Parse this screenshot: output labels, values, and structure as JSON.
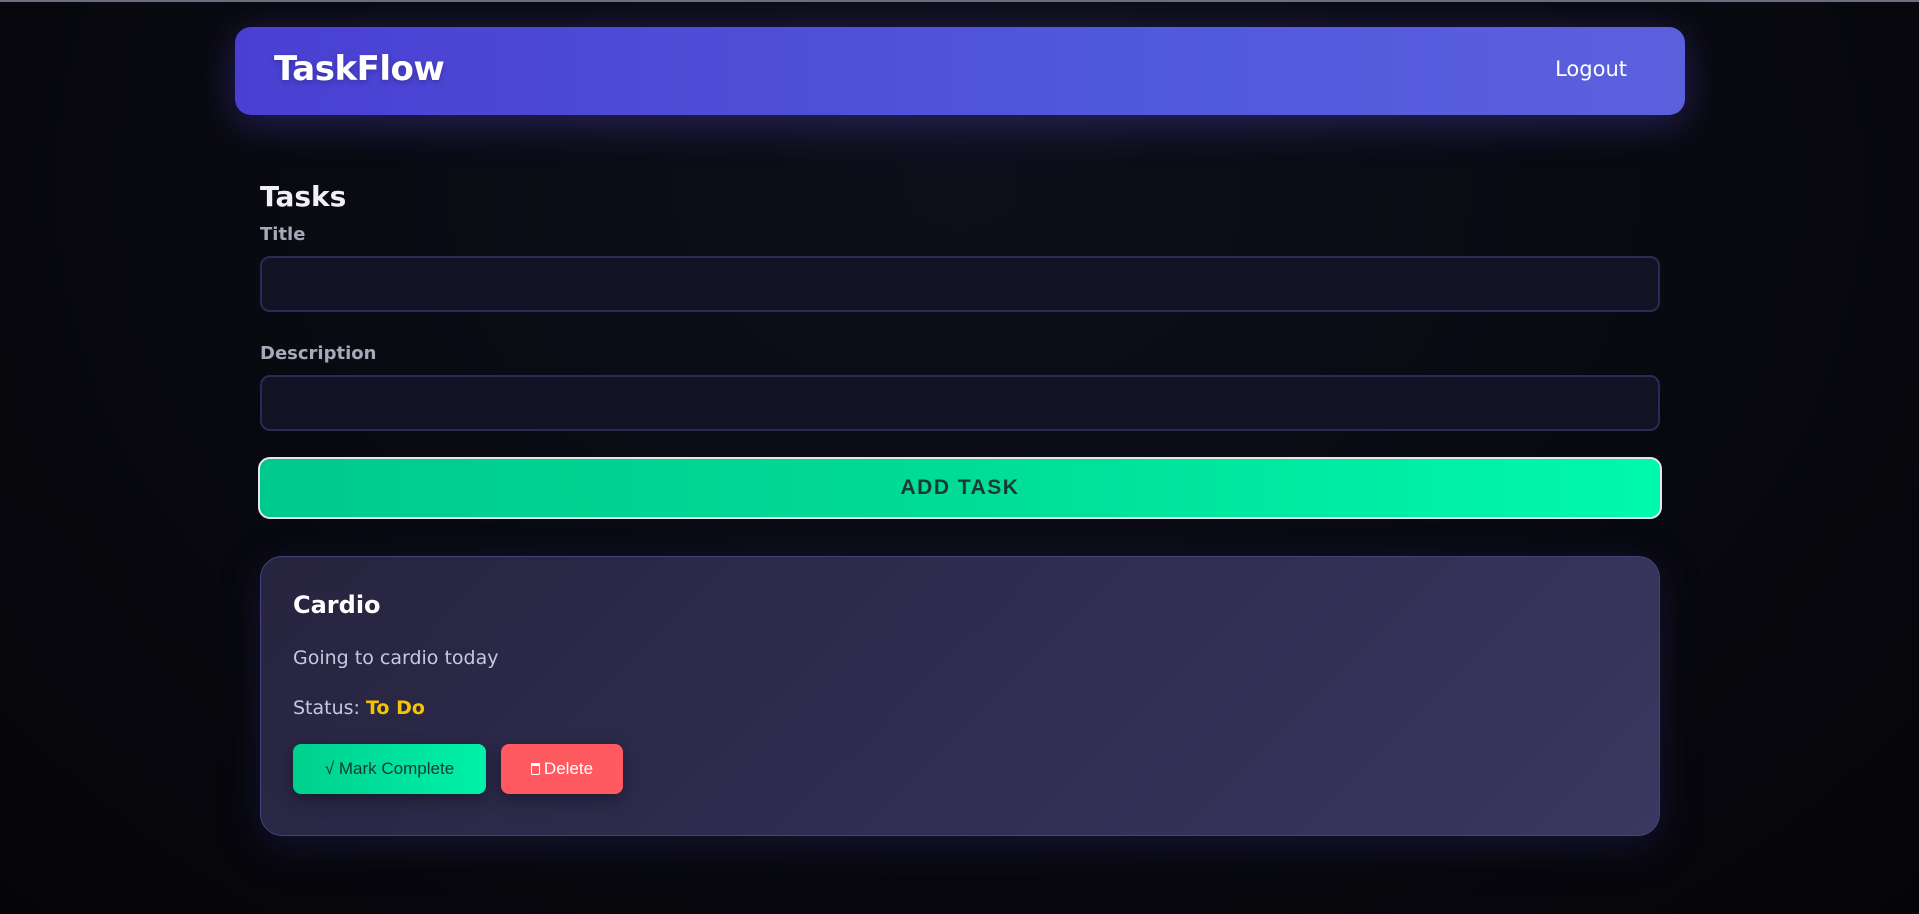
{
  "header": {
    "brand": "TaskFlow",
    "logout_label": "Logout"
  },
  "main": {
    "section_title": "Tasks",
    "form": {
      "title_label": "Title",
      "title_value": "",
      "title_placeholder": "",
      "description_label": "Description",
      "description_value": "",
      "description_placeholder": "",
      "add_button_label": "ADD TASK"
    },
    "tasks": [
      {
        "title": "Cardio",
        "description": "Going to cardio today",
        "status_label": "Status:",
        "status_value": "To Do",
        "complete_label": "√ Mark Complete",
        "delete_label": "Delete",
        "delete_icon": "trash-icon"
      }
    ]
  },
  "colors": {
    "accent": "#4f4fd8",
    "add_button": "#00e09a",
    "status_todo": "#f5c400",
    "delete": "#ff5a5f"
  }
}
